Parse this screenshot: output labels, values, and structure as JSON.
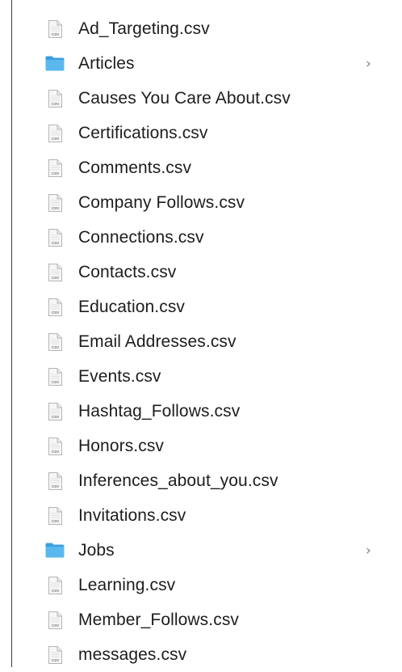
{
  "files": [
    {
      "name": "Ad_Targeting.csv",
      "kind": "csv",
      "icon": "csv-file-icon",
      "has_chevron": false
    },
    {
      "name": "Articles",
      "kind": "folder",
      "icon": "folder-icon",
      "has_chevron": true
    },
    {
      "name": "Causes You Care About.csv",
      "kind": "csv",
      "icon": "csv-file-icon",
      "has_chevron": false
    },
    {
      "name": "Certifications.csv",
      "kind": "csv",
      "icon": "csv-file-icon",
      "has_chevron": false
    },
    {
      "name": "Comments.csv",
      "kind": "csv",
      "icon": "csv-file-icon",
      "has_chevron": false
    },
    {
      "name": "Company Follows.csv",
      "kind": "csv",
      "icon": "csv-file-icon",
      "has_chevron": false
    },
    {
      "name": "Connections.csv",
      "kind": "csv",
      "icon": "csv-file-icon",
      "has_chevron": false
    },
    {
      "name": "Contacts.csv",
      "kind": "csv",
      "icon": "csv-file-icon",
      "has_chevron": false
    },
    {
      "name": "Education.csv",
      "kind": "csv",
      "icon": "csv-file-icon",
      "has_chevron": false
    },
    {
      "name": "Email Addresses.csv",
      "kind": "csv",
      "icon": "csv-file-icon",
      "has_chevron": false
    },
    {
      "name": "Events.csv",
      "kind": "csv",
      "icon": "csv-file-icon",
      "has_chevron": false
    },
    {
      "name": "Hashtag_Follows.csv",
      "kind": "csv",
      "icon": "csv-file-icon",
      "has_chevron": false
    },
    {
      "name": "Honors.csv",
      "kind": "csv",
      "icon": "csv-file-icon",
      "has_chevron": false
    },
    {
      "name": "Inferences_about_you.csv",
      "kind": "csv",
      "icon": "csv-file-icon",
      "has_chevron": false
    },
    {
      "name": "Invitations.csv",
      "kind": "csv",
      "icon": "csv-file-icon",
      "has_chevron": false
    },
    {
      "name": "Jobs",
      "kind": "folder",
      "icon": "folder-icon",
      "has_chevron": true
    },
    {
      "name": "Learning.csv",
      "kind": "csv",
      "icon": "csv-file-icon",
      "has_chevron": false
    },
    {
      "name": "Member_Follows.csv",
      "kind": "csv",
      "icon": "csv-file-icon",
      "has_chevron": false
    },
    {
      "name": "messages.csv",
      "kind": "csv",
      "icon": "csv-file-icon",
      "has_chevron": false
    }
  ],
  "chevron_glyph": "›",
  "csv_badge": "CSV",
  "colors": {
    "text": "#1d1d1d",
    "folder": "#5ab8ee",
    "folder_tab": "#3a9fdc",
    "chevron": "#7d7d7d",
    "file_outline": "#b5b5b5",
    "file_fill": "#f6f6f6"
  }
}
